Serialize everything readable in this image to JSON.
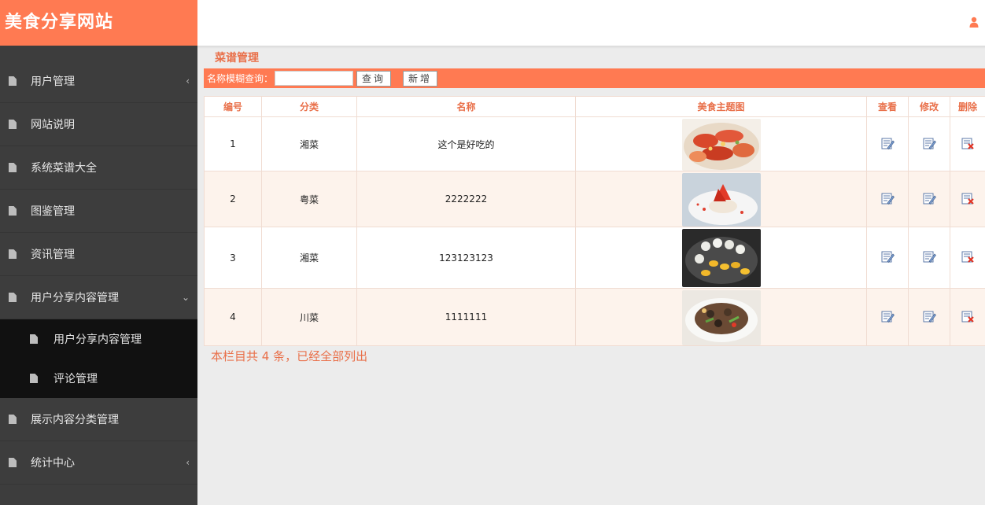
{
  "brand": "美食分享网站",
  "sidebar": {
    "items": [
      {
        "label": "用户管理",
        "chevron": "left"
      },
      {
        "label": "网站说明"
      },
      {
        "label": "系统菜谱大全"
      },
      {
        "label": "图鉴管理"
      },
      {
        "label": "资讯管理"
      },
      {
        "label": "用户分享内容管理",
        "chevron": "down"
      },
      {
        "label": "展示内容分类管理"
      },
      {
        "label": "统计中心",
        "chevron": "left"
      }
    ],
    "sub_items": [
      {
        "label": "用户分享内容管理"
      },
      {
        "label": "评论管理"
      }
    ]
  },
  "header": {
    "user_icon": "user-icon"
  },
  "main": {
    "title": "菜谱管理",
    "search_label": "名称模糊查询：",
    "search_value": "",
    "query_label": "查询",
    "add_label": "新增"
  },
  "table": {
    "headers": [
      "编号",
      "分类",
      "名称",
      "美食主题图",
      "查看",
      "修改",
      "删除"
    ],
    "rows": [
      {
        "id": "1",
        "category": "湘菜",
        "name": "这个是好吃的",
        "image": "shrimp-dish"
      },
      {
        "id": "2",
        "category": "粤菜",
        "name": "2222222",
        "image": "dessert-plate"
      },
      {
        "id": "3",
        "category": "湘菜",
        "name": "123123123",
        "image": "dumpling-platter"
      },
      {
        "id": "4",
        "category": "川菜",
        "name": "1111111",
        "image": "stir-fry-dish"
      }
    ]
  },
  "footer": {
    "summary": "本栏目共 4 条，已经全部列出"
  },
  "colors": {
    "accent": "#ff7a52",
    "sidebar": "#3d3d3d",
    "submenu": "#111111",
    "title": "#e9704a"
  }
}
